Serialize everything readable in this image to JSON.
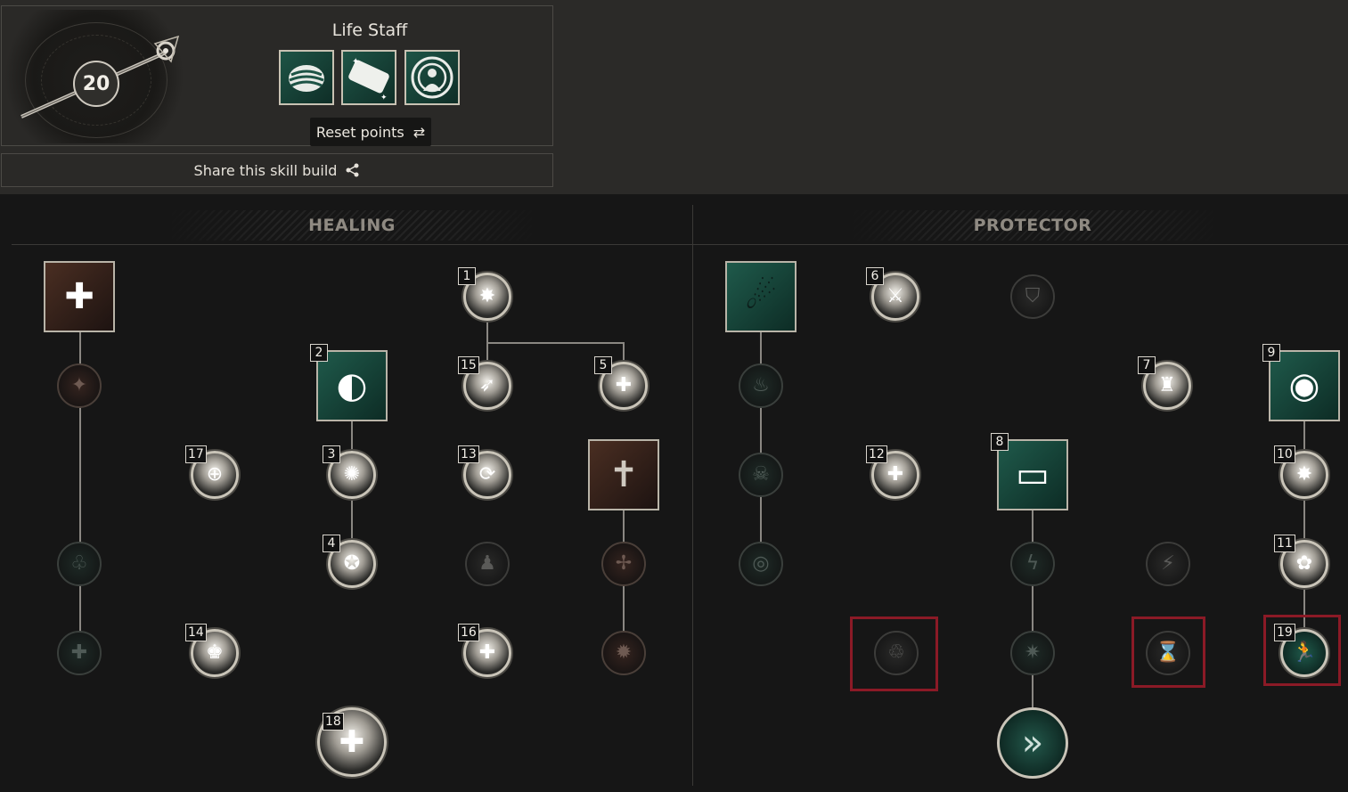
{
  "header": {
    "level": "20",
    "weapon_name": "Life Staff",
    "reset_label": "Reset points",
    "equipped": [
      {
        "icon": "orb-wave-icon"
      },
      {
        "icon": "scroll-band-icon"
      },
      {
        "icon": "radiant-figure-icon"
      }
    ]
  },
  "share": {
    "label": "Share this skill build"
  },
  "trees": {
    "healing": {
      "title": "HEALING"
    },
    "protector": {
      "title": "PROTECTOR"
    }
  },
  "nodes": {
    "h_big_1": {
      "glyph": "✚",
      "icon": "holy-cross-icon"
    },
    "h_node_l1": {
      "glyph": "✦",
      "icon": "star-burst-icon"
    },
    "h_node_l2": {
      "glyph": "♧",
      "icon": "cross-cluster-icon"
    },
    "h_node_l3": {
      "glyph": "✚",
      "icon": "plus-icon"
    },
    "n1": {
      "order": "1",
      "glyph": "✸",
      "icon": "light-burst-icon"
    },
    "n2": {
      "order": "2",
      "glyph": "◐",
      "icon": "orb-wave-icon"
    },
    "n15": {
      "order": "15",
      "glyph": "➶",
      "icon": "bolt-arrow-icon"
    },
    "n5": {
      "order": "5",
      "glyph": "✚",
      "icon": "plus-circle-icon"
    },
    "n17": {
      "order": "17",
      "glyph": "⊕",
      "icon": "medic-cross-icon"
    },
    "n3": {
      "order": "3",
      "glyph": "✺",
      "icon": "splash-icon"
    },
    "n13": {
      "order": "13",
      "glyph": "⟳",
      "icon": "cycle-icon"
    },
    "h_big_group": {
      "glyph": "✝",
      "icon": "group-cross-icon"
    },
    "n4": {
      "order": "4",
      "glyph": "✪",
      "icon": "up-burst-icon"
    },
    "h_inactive_group": {
      "glyph": "♟",
      "icon": "group-star-icon"
    },
    "h_inactive_plus": {
      "glyph": "✢",
      "icon": "plus-plus-icon"
    },
    "n14": {
      "order": "14",
      "glyph": "♚",
      "icon": "group-plus-icon"
    },
    "n16": {
      "order": "16",
      "glyph": "✚",
      "icon": "plus-split-icon"
    },
    "h_inactive_burst": {
      "glyph": "✹",
      "icon": "burst-icon"
    },
    "n18": {
      "order": "18",
      "glyph": "✚",
      "icon": "ultimate-cross-icon"
    },
    "p_big_1": {
      "glyph": "☄",
      "icon": "comet-icon"
    },
    "p_node_l1": {
      "glyph": "♨",
      "icon": "flame-icon"
    },
    "p_node_l2": {
      "glyph": "☠",
      "icon": "skull-icon"
    },
    "p_node_l3": {
      "glyph": "◎",
      "icon": "ring-icon"
    },
    "n6": {
      "order": "6",
      "glyph": "⚔",
      "icon": "strike-icon"
    },
    "p_inactive_shield": {
      "glyph": "⛉",
      "icon": "shield-icon"
    },
    "n7": {
      "order": "7",
      "glyph": "♜",
      "icon": "armor-icon"
    },
    "n9": {
      "order": "9",
      "glyph": "◉",
      "icon": "radiant-figure-icon"
    },
    "n12": {
      "order": "12",
      "glyph": "✚",
      "icon": "plus-sparkle-icon"
    },
    "n8": {
      "order": "8",
      "glyph": "▭",
      "icon": "scroll-band-icon"
    },
    "n10": {
      "order": "10",
      "glyph": "✸",
      "icon": "sun-burst-icon"
    },
    "p_inactive_lightning": {
      "glyph": "ϟ",
      "icon": "lightning-icon"
    },
    "p_inactive_run": {
      "glyph": "⚡",
      "icon": "dash-icon"
    },
    "n11": {
      "order": "11",
      "glyph": "✿",
      "icon": "flower-cross-icon"
    },
    "p_inactive_revive": {
      "glyph": "♲",
      "icon": "revive-group-icon"
    },
    "p_inactive_burst": {
      "glyph": "✷",
      "icon": "green-burst-icon"
    },
    "p_inactive_hourglass": {
      "glyph": "⌛",
      "icon": "hourglass-icon"
    },
    "n19": {
      "order": "19",
      "glyph": "🏃",
      "icon": "runner-icon"
    },
    "p_ultimate": {
      "glyph": "»",
      "icon": "charge-shield-icon"
    }
  }
}
